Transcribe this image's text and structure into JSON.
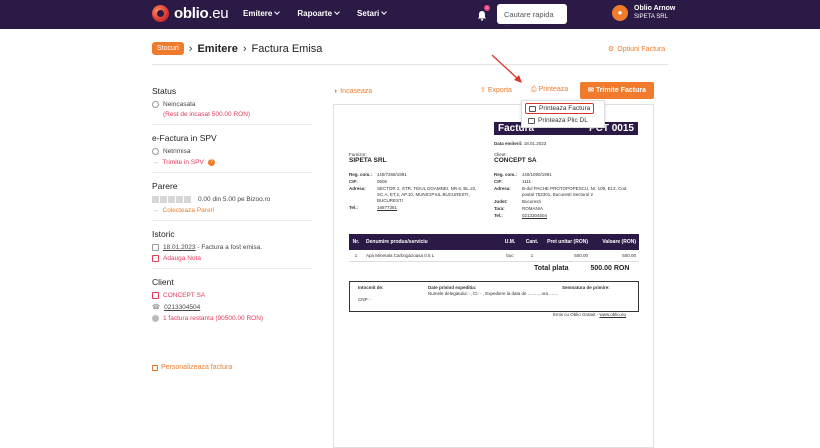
{
  "nav": {
    "logo_main": "oblio",
    "logo_suffix": ".eu",
    "links": [
      {
        "label": "Emitere"
      },
      {
        "label": "Rapoarte"
      },
      {
        "label": "Setari"
      }
    ],
    "bell_count": "1",
    "search_placeholder": "Cautare rapida ...",
    "user_name": "Oblio Arnow",
    "user_company": "SIPETA SRL"
  },
  "breadcrumb": {
    "badge": "Stocuri",
    "items": [
      "Emitere",
      "Factura Emisa"
    ]
  },
  "options_label": "Optiuni Factura",
  "left": {
    "status_title": "Status",
    "status_value": "Neincasata",
    "status_rest": "(Rest de incasat 500.00 RON)",
    "efactura_title": "e-Factura in SPV",
    "efactura_value": "Netrimisa",
    "efactura_action": "Trimite in SPV",
    "parere_title": "Parere",
    "parere_value": "0.00 din 5.00 pe Bizoo.ro",
    "parere_action": "Colecteaza Pareri",
    "istoric_title": "Istoric",
    "istoric_date": "18.01.2023",
    "istoric_text": " - Factura a fost emisa.",
    "istoric_action": "Adauga Nota",
    "client_title": "Client",
    "client_name": "CONCEPT SA",
    "client_phone": "0213304504",
    "client_debt": "1 factura restanta (90500.00 RON)",
    "personalize": "Personalizeaza factura"
  },
  "actions": {
    "incaseaza": "Incaseaza",
    "exporta": "Exporta",
    "printeaza": "Printeaza",
    "trimite": "Trimite Factura"
  },
  "dropdown": {
    "items": [
      "Printeaza Factura",
      "Printeaza Plic DL"
    ]
  },
  "invoice": {
    "title_left": "Factura",
    "title_right": "PCT 0015",
    "date_label": "Data emiterii:",
    "date_value": "18.01.2023",
    "supplier": {
      "label": "Furnizor:",
      "name": "SIPETA SRL",
      "reg_k": "Reg. com.:",
      "reg_v": "J40/7268/1991",
      "cif_k": "CIF:",
      "cif_v": "0606",
      "adr_k": "Adresa:",
      "adr_v": "SECTOR 2, STR. TEIUL DOAMNEI, NR.6, BL.22, SC.A, ET.2, AP.10, MUNICIPIUL BUCURESTI, BUCURESTI",
      "tel_k": "Tel.:",
      "tel_v": "16877361"
    },
    "client": {
      "label": "Client:",
      "name": "CONCEPT SA",
      "reg_k": "Reg. com.:",
      "reg_v": "J40/1090/1991",
      "cif_k": "CIF:",
      "cif_v": "1111",
      "adr_k": "Adresa:",
      "adr_v": "B-dul PACHE PROTOPOPESCU, Nr. 109, Et.2, Cod postal 752301, Bucuresti Sectorul 2",
      "jud_k": "Judet:",
      "jud_v": "Bucuresti",
      "tara_k": "Tara:",
      "tara_v": "ROMANIA",
      "tel_k": "Tel.:",
      "tel_v": "0213304504"
    },
    "headers": [
      "Nr.",
      "Denumire produs/serviciu",
      "U.M.",
      "Cant.",
      "Pret unitar (RON)",
      "Valoare (RON)"
    ],
    "rows": [
      [
        "1",
        "Apa Minerala Carbogazoasa 0.5 L",
        "buc",
        "1",
        "500.00",
        "500.00"
      ]
    ],
    "total_label": "Total plata",
    "total_value": "500.00 RON",
    "foot_intocmit": "Intocmit de:",
    "foot_cnp": "CNP: -",
    "foot_exp": "Date privind expeditia:",
    "foot_exp_line": "Numele delegatului: -, CI: - , Expediere la data de ........., ora .......",
    "foot_sem": "Semnatura de primire:",
    "emis_prefix": "Emis cu Oblio Gratuit - ",
    "emis_link": "www.oblio.eu"
  }
}
